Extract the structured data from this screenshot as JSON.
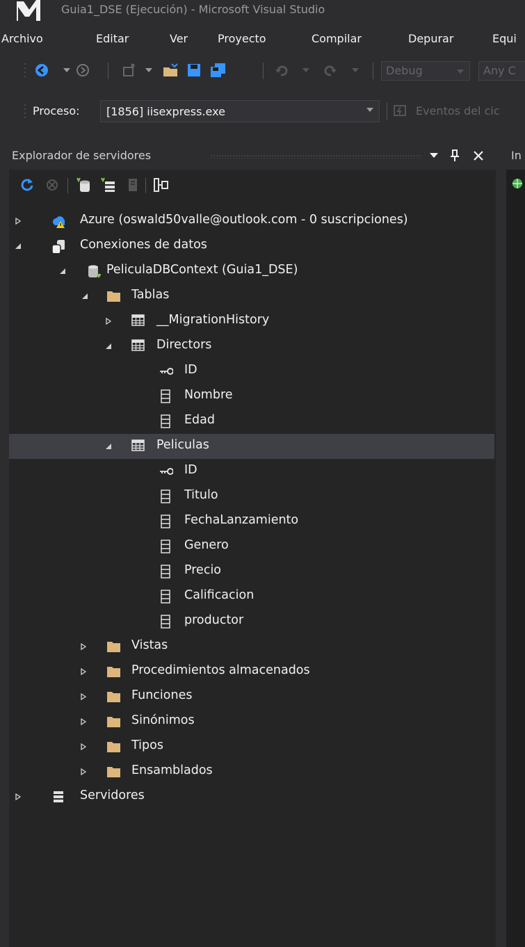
{
  "window": {
    "title": "Guia1_DSE (Ejecución) - Microsoft Visual Studio"
  },
  "menu": [
    "Archivo",
    "Editar",
    "Ver",
    "Proyecto",
    "Compilar",
    "Depurar",
    "Equi"
  ],
  "toolbar": {
    "config": "Debug",
    "platform": "Any C"
  },
  "process": {
    "label": "Proceso:",
    "value": "[1856] iisexpress.exe",
    "events": "Eventos del cic"
  },
  "panel": {
    "title": "Explorador de servidores"
  },
  "tree": {
    "azure": "Azure (oswald50valle@outlook.com - 0 suscripciones)",
    "conexiones": "Conexiones de datos",
    "context": "PeliculaDBContext (Guia1_DSE)",
    "tablas": "Tablas",
    "migration": "__MigrationHistory",
    "directors": "Directors",
    "directors_cols": [
      "ID",
      "Nombre",
      "Edad"
    ],
    "peliculas": "Peliculas",
    "peliculas_cols": [
      "ID",
      "Titulo",
      "FechaLanzamiento",
      "Genero",
      "Precio",
      "Calificacion",
      "productor"
    ],
    "folders": [
      "Vistas",
      "Procedimientos almacenados",
      "Funciones",
      "Sinónimos",
      "Tipos",
      "Ensamblados"
    ],
    "servidores": "Servidores"
  },
  "right_panel": {
    "tab": "In"
  },
  "colors": {
    "accent": "#0e70c0",
    "folder": "#dcb67a",
    "background": "#252526",
    "selection": "#3f3f46"
  }
}
